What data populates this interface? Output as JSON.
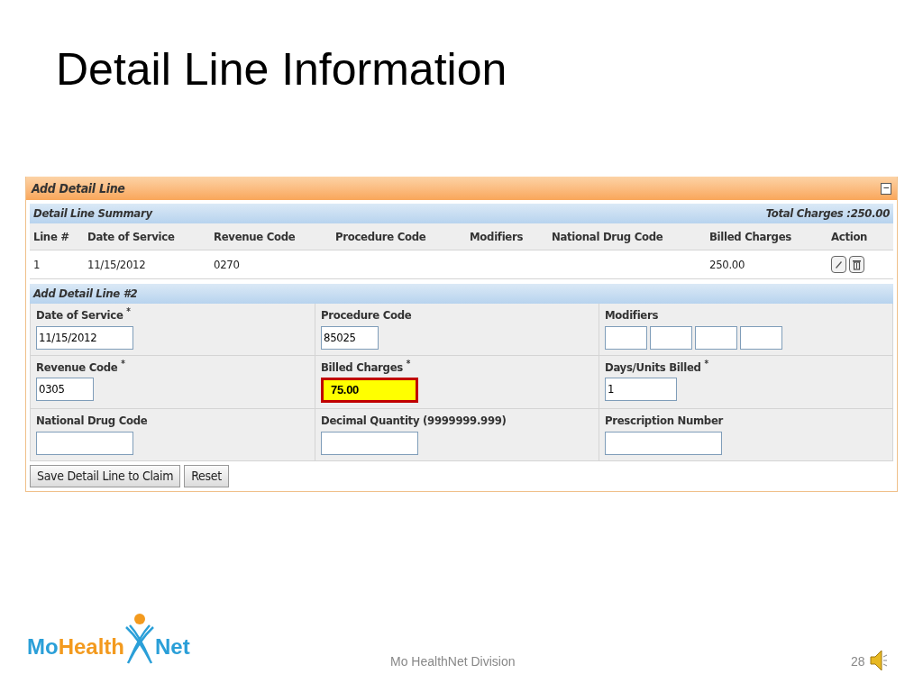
{
  "slide": {
    "title": "Detail Line Information",
    "footer": "Mo HealthNet Division",
    "page_number": "28"
  },
  "logo": {
    "parts": [
      "Mo",
      "Health",
      "Net"
    ]
  },
  "panel": {
    "title": "Add Detail Line",
    "collapse": "−",
    "summary": {
      "title": "Detail Line Summary",
      "total": "Total Charges :250.00",
      "columns": [
        "Line #",
        "Date of Service",
        "Revenue Code",
        "Procedure Code",
        "Modifiers",
        "National Drug Code",
        "Billed Charges",
        "Action"
      ],
      "rows": [
        {
          "cells": [
            "1",
            "11/15/2012",
            "0270",
            "",
            "",
            "",
            "250.00"
          ]
        }
      ]
    },
    "form": {
      "title": "Add Detail Line #2",
      "fields": [
        {
          "kind": "text",
          "label": "Date of Service $^{*}$",
          "value": "11/15/2012",
          "highlighted": false
        },
        {
          "kind": "text",
          "label": "Procedure Code",
          "value": "85025",
          "highlighted": false
        },
        {
          "kind": "modifier_boxes",
          "label": "Modifiers"
        },
        {
          "kind": "text",
          "label": "Revenue Code $^{*}$",
          "value": "0305",
          "highlighted": false
        },
        {
          "kind": "text",
          "label": "Billed Charges $^{*}$",
          "value": "75.00",
          "highlighted": true
        },
        {
          "kind": "text",
          "label": "Days/Units Billed $^{*}$",
          "value": "1",
          "highlighted": false
        },
        {
          "kind": "text",
          "label": "National Drug Code",
          "highlighted": false
        },
        {
          "kind": "text",
          "label": "Decimal Quantity (9999999.999)",
          "highlighted": false
        },
        {
          "kind": "text",
          "label": "Prescription Number",
          "highlighted": false
        }
      ],
      "buttons": [
        "Save Detail Line to Claim",
        "Reset"
      ]
    }
  }
}
